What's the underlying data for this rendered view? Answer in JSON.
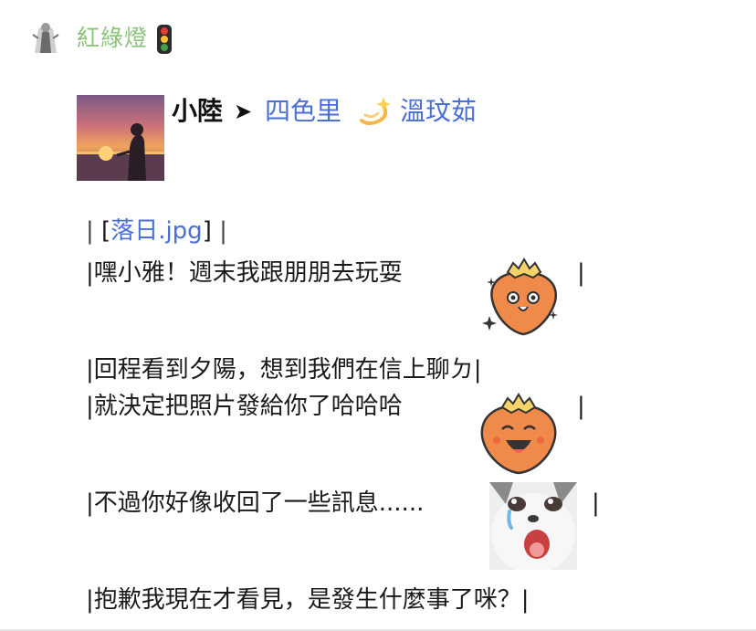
{
  "header": {
    "name": "紅綠燈"
  },
  "post": {
    "from": "小陸",
    "arrow": "➤",
    "to_part1": "四色里",
    "to_part2": "溫玟茹"
  },
  "lines": {
    "l1_bar_left": "|",
    "l1_bracket_open": "[",
    "l1_link": "落日.jpg",
    "l1_bracket_close": "]",
    "l1_bar_right": "|",
    "l2": "|嘿小雅！週末我跟朋朋去玩耍",
    "l2_bar": "|",
    "l3": "|回程看到夕陽，想到我們在信上聊ㄉ|",
    "l4": "|就決定把照片發給你了哈哈哈",
    "l4_bar": "|",
    "l5": "|不過你好像收回了一些訊息......",
    "l5_bar": "|",
    "l6": "|抱歉我現在才看見，是發生什麼事了咪？|"
  },
  "icons": {
    "traffic": "traffic-light-icon",
    "spark": "dizzy-sparkle-icon"
  },
  "colors": {
    "header_name": "#8cc37a",
    "link_blue": "#4a6fd6",
    "strawberry": "#f08a4b"
  }
}
